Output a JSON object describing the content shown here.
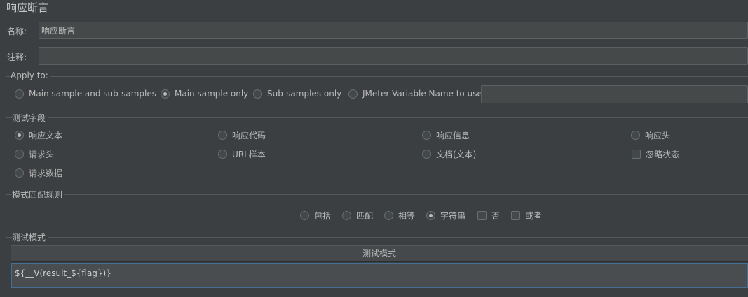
{
  "panel_title": "响应断言",
  "name": {
    "label": "名称:",
    "value": "响应断言"
  },
  "comment": {
    "label": "注释:",
    "value": ""
  },
  "apply_to": {
    "title": "Apply to:",
    "options": [
      {
        "label": "Main sample and sub-samples",
        "selected": false
      },
      {
        "label": "Main sample only",
        "selected": true
      },
      {
        "label": "Sub-samples only",
        "selected": false
      },
      {
        "label": "JMeter Variable Name to use",
        "selected": false
      }
    ],
    "variable_value": ""
  },
  "test_field": {
    "title": "测试字段",
    "options": [
      {
        "label": "响应文本",
        "type": "radio",
        "selected": true
      },
      {
        "label": "响应代码",
        "type": "radio",
        "selected": false
      },
      {
        "label": "响应信息",
        "type": "radio",
        "selected": false
      },
      {
        "label": "响应头",
        "type": "radio",
        "selected": false
      },
      {
        "label": "请求头",
        "type": "radio",
        "selected": false
      },
      {
        "label": "URL样本",
        "type": "radio",
        "selected": false
      },
      {
        "label": "文档(文本)",
        "type": "radio",
        "selected": false
      },
      {
        "label": "忽略状态",
        "type": "checkbox",
        "checked": false
      },
      {
        "label": "请求数据",
        "type": "radio",
        "selected": false
      }
    ]
  },
  "pattern_rules": {
    "title": "模式匹配规则",
    "options": [
      {
        "label": "包括",
        "type": "radio",
        "selected": false
      },
      {
        "label": "匹配",
        "type": "radio",
        "selected": false
      },
      {
        "label": "相等",
        "type": "radio",
        "selected": false
      },
      {
        "label": "字符串",
        "type": "radio",
        "selected": true
      },
      {
        "label": "否",
        "type": "checkbox",
        "checked": false
      },
      {
        "label": "或者",
        "type": "checkbox",
        "checked": false
      }
    ]
  },
  "test_patterns": {
    "title": "测试模式",
    "column_header": "测试模式",
    "rows": [
      "${__V(result_${flag})}"
    ]
  }
}
